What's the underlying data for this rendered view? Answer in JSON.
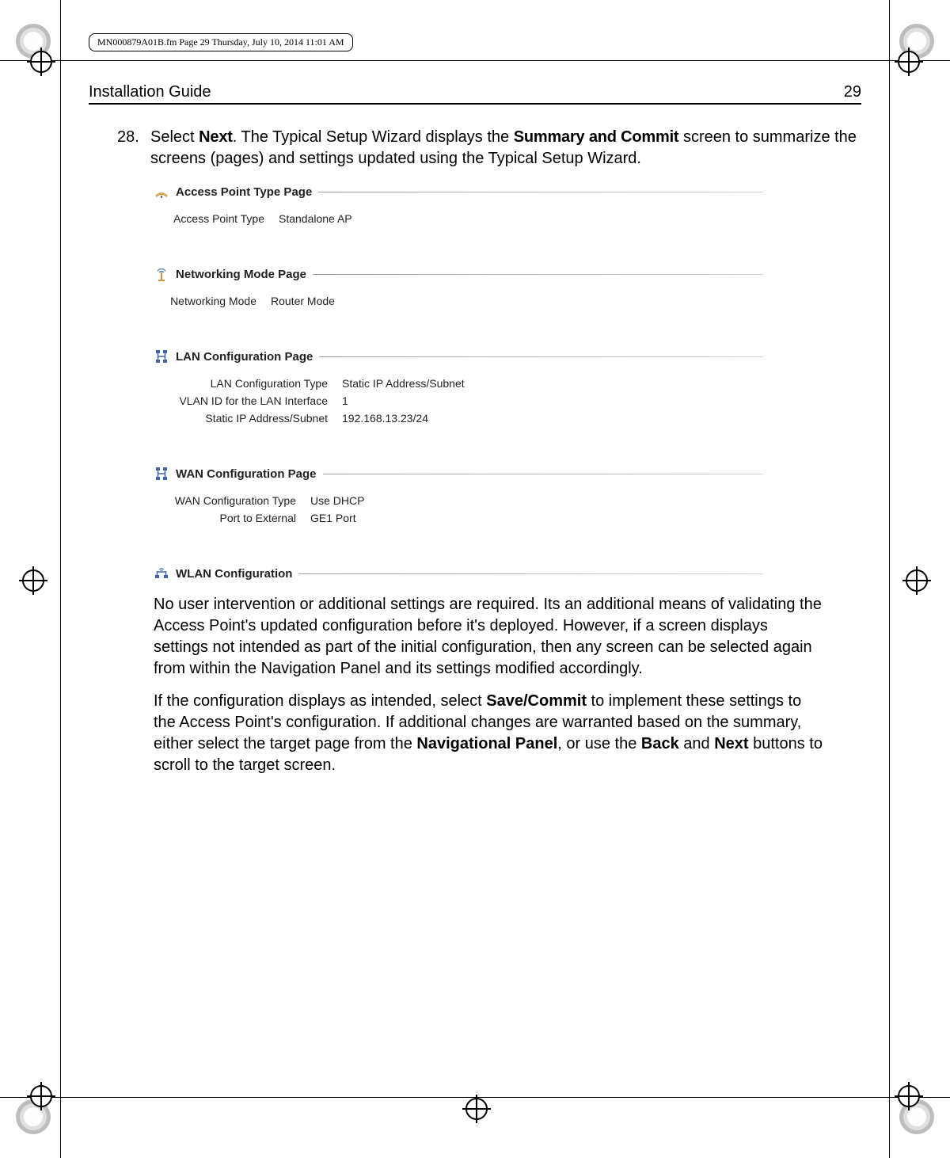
{
  "header_strip": "MN000879A01B.fm  Page 29  Thursday, July 10, 2014  11:01 AM",
  "running_head": {
    "title": "Installation Guide",
    "page": "29"
  },
  "step": {
    "num": "28.",
    "text_parts": {
      "p1": "Select ",
      "b1": "Next",
      "p2": ". The Typical Setup Wizard displays the ",
      "b2": "Summary and Commit",
      "p3": " screen to summarize the screens (pages) and settings updated using the Typical Setup Wizard."
    }
  },
  "groups": {
    "ap": {
      "title": "Access Point Type Page",
      "rows": [
        {
          "k": "Access Point Type",
          "v": "Standalone AP",
          "kw": 140
        }
      ]
    },
    "net": {
      "title": "Networking Mode Page",
      "rows": [
        {
          "k": "Networking Mode",
          "v": "Router Mode",
          "kw": 130
        }
      ]
    },
    "lan": {
      "title": "LAN Configuration Page",
      "rows": [
        {
          "k": "LAN Configuration Type",
          "v": "Static IP Address/Subnet",
          "kw": 220
        },
        {
          "k": "VLAN ID for the LAN Interface",
          "v": "1",
          "kw": 220
        },
        {
          "k": "Static IP Address/Subnet",
          "v": "192.168.13.23/24",
          "kw": 220
        }
      ]
    },
    "wan": {
      "title": "WAN Configuration Page",
      "rows": [
        {
          "k": "WAN Configuration Type",
          "v": "Use DHCP",
          "kw": 180
        },
        {
          "k": "Port to External",
          "v": "GE1 Port",
          "kw": 180
        }
      ]
    },
    "wlan": {
      "title": "WLAN Configuration"
    }
  },
  "para1": "No user intervention or additional settings are required. Its an additional means of validating the Access Point's updated configuration before it's deployed. However, if a screen displays settings not intended as part of the initial configuration, then any screen can be selected again from within the Navigation Panel and its settings modified accordingly.",
  "para2": {
    "p1": "If the configuration displays as intended, select ",
    "b1": "Save/Commit",
    "p2": " to implement these settings to the Access Point's configuration. If additional changes are warranted based on the summary, either select the target page from the ",
    "b2": "Navigational Panel",
    "p3": ", or use the ",
    "b3": "Back",
    "p4": " and ",
    "b4": "Next",
    "p5": " buttons to scroll to the target screen."
  }
}
